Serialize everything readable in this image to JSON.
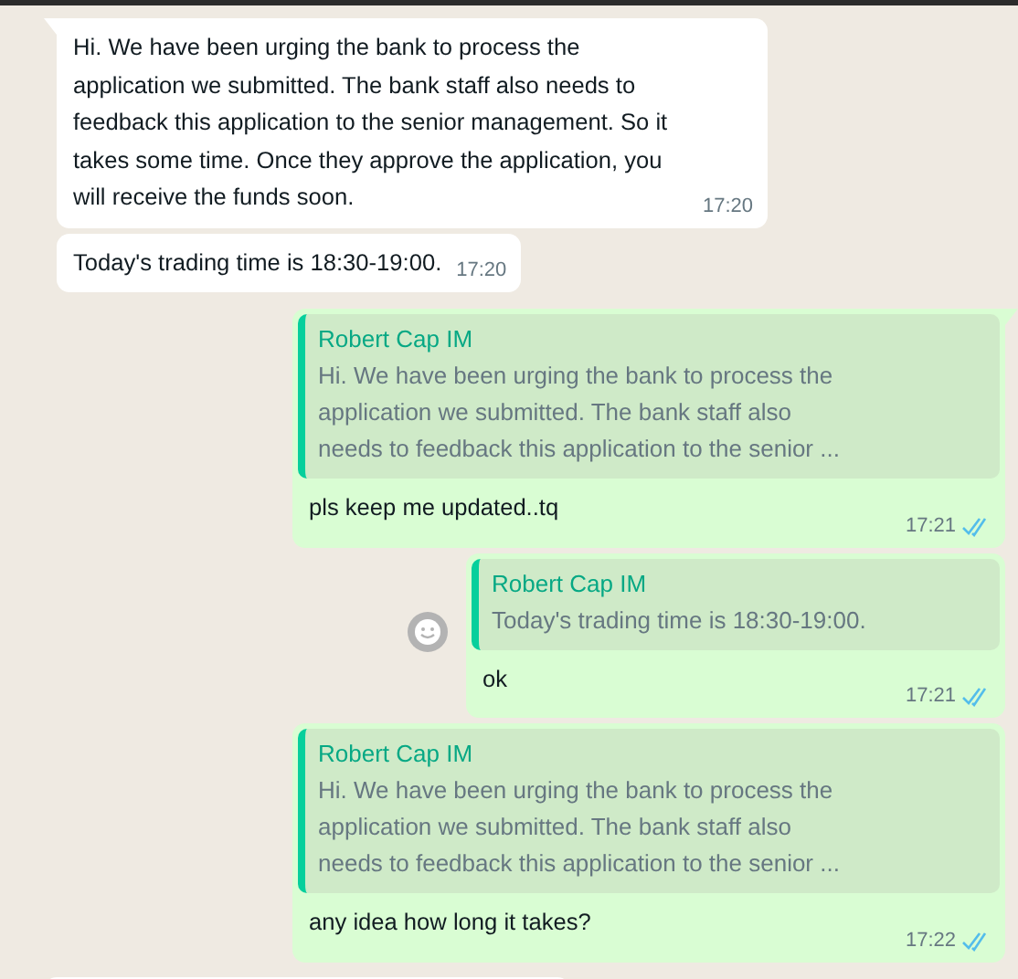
{
  "messages": [
    {
      "kind": "incoming",
      "text": "Hi. We have been urging the bank to process the application we submitted. The bank staff also needs to feedback this application to the senior management. So it takes some time. Once they approve the application, you will receive the funds soon.",
      "time": "17:20",
      "tail": true
    },
    {
      "kind": "incoming",
      "text": "Today's trading time is 18:30-19:00.",
      "time": "17:20",
      "tail": false
    },
    {
      "kind": "outgoing",
      "quote": {
        "author": "Robert Cap IM",
        "text": "Hi. We have been urging the bank to process the application we submitted. The bank staff also needs to feedback this application to the senior ..."
      },
      "text": "pls keep me updated..tq",
      "time": "17:21",
      "read": true,
      "tail": true,
      "reaction_button": false
    },
    {
      "kind": "outgoing",
      "quote": {
        "author": "Robert Cap IM",
        "text": "Today's trading time is 18:30-19:00."
      },
      "text": "ok",
      "time": "17:21",
      "read": true,
      "tail": false,
      "reaction_button": true
    },
    {
      "kind": "outgoing",
      "quote": {
        "author": "Robert Cap IM",
        "text": "Hi. We have been urging the bank to process the application we submitted. The bank staff also needs to feedback this application to the senior ..."
      },
      "text": "any idea how long it takes?",
      "time": "17:22",
      "read": true,
      "tail": false,
      "reaction_button": false
    },
    {
      "kind": "incoming"
    }
  ]
}
